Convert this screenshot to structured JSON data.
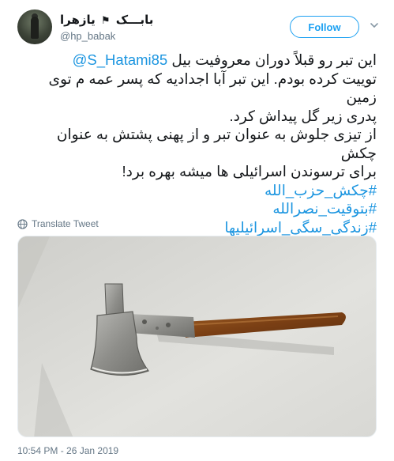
{
  "author": {
    "name_part1": "بابـــک",
    "name_part2": "یازهرا",
    "handle": "@hp_babak",
    "avatar_icon": "avatar"
  },
  "actions": {
    "follow_label": "Follow",
    "menu_icon": "chevron-down-icon"
  },
  "tweet": {
    "line1_text": "این تبر رو قبلاً دوران معروفیت بیل ",
    "line1_mention": "@S_Hatami85",
    "line2": "توییت کرده بودم. این تبر آبا اجدادیه که پسر عمه م توی زمین",
    "line3": "پدری زیر گل پیداش کرد.",
    "line4": "از تیزی جلوش به عنوان تبر و از پهنی پشتش به عنوان چکش",
    "line5": "برای ترسوندن اسرائیلی ها میشه بهره برد!",
    "hashtag1": "#چکش_حزب_الله",
    "hashtag2": "#بتوقیت_نصرالله",
    "hashtag3": "#زندگی_سگی_اسرائیلیها"
  },
  "translate_label": "Translate Tweet",
  "timestamp": "10:54 PM - 26 Jan 2019",
  "colors": {
    "accent": "#1da1f2",
    "link": "#1b95e0",
    "secondary_text": "#657786"
  }
}
